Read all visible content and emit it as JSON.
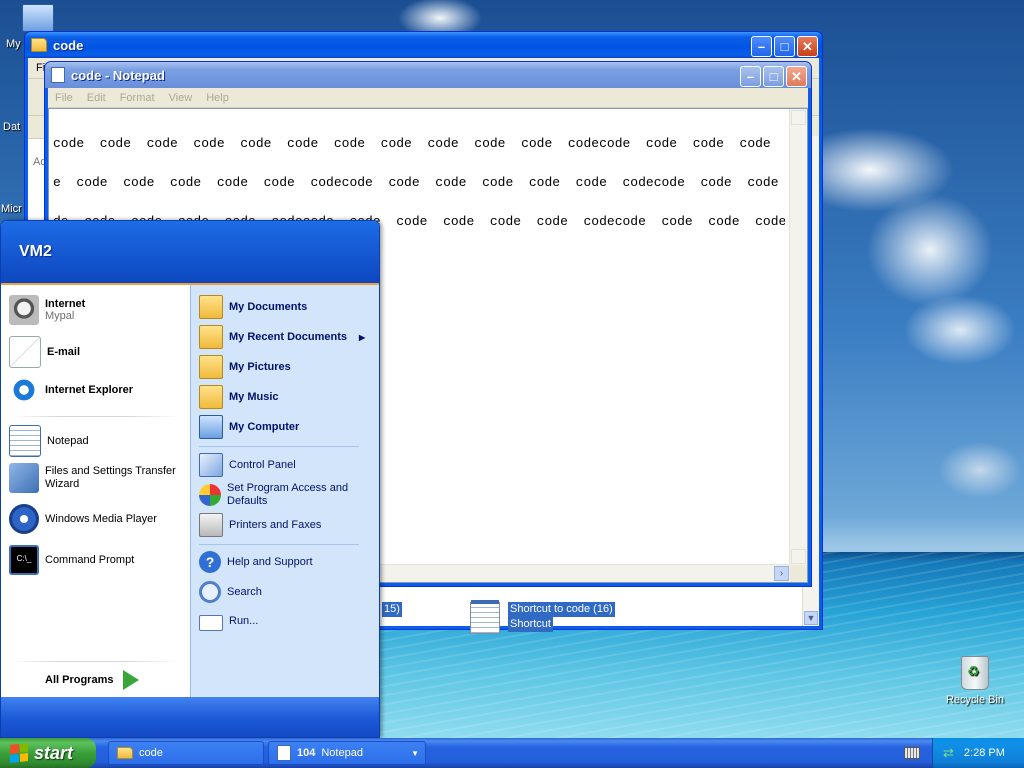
{
  "desktop": {
    "icons_left": [
      "My",
      "Dat",
      "Micr"
    ],
    "recycle_bin": "Recycle Bin"
  },
  "explorer": {
    "title": "code",
    "menu_first": "Fi",
    "toolbar_fragment": "Ad",
    "items": [
      {
        "label": "15)"
      },
      {
        "label": "Shortcut to code (16)",
        "sub": "Shortcut"
      }
    ]
  },
  "notepad": {
    "title": "code - Notepad",
    "menu": [
      "File",
      "Edit",
      "Format",
      "View",
      "Help"
    ],
    "lines": [
      "code  code  code  code  code  code  code  code  code  code  code  codecode  code  code  code  cod",
      "e  code  code  code  code  code  codecode  code  code  code  code  code  codecode  code  code  code  co",
      "de  code  code  code  code  codecode  code  code  code  code  code  codecode  code  code  code  code  c"
    ]
  },
  "startmenu": {
    "user": "VM2",
    "pinned": [
      {
        "label": "Internet",
        "sub": "Mypal",
        "icon": "raccoon-icon"
      },
      {
        "label": "E-mail",
        "icon": "email-icon"
      },
      {
        "label": "Internet Explorer",
        "icon": "ie-icon"
      }
    ],
    "recent": [
      {
        "label": "Notepad",
        "icon": "notepad-icon"
      },
      {
        "label": "Files and Settings Transfer Wizard",
        "icon": "transfer-wizard-icon"
      },
      {
        "label": "Windows Media Player",
        "icon": "media-player-icon"
      },
      {
        "label": "Command Prompt",
        "icon": "command-prompt-icon"
      }
    ],
    "all_programs": "All Programs",
    "places": [
      {
        "label": "My Documents"
      },
      {
        "label": "My Recent Documents"
      },
      {
        "label": "My Pictures"
      },
      {
        "label": "My Music"
      },
      {
        "label": "My Computer"
      }
    ],
    "settings": [
      {
        "label": "Control Panel"
      },
      {
        "label": "Set Program Access and Defaults"
      },
      {
        "label": "Printers and Faxes"
      }
    ],
    "help": [
      {
        "label": "Help and Support"
      },
      {
        "label": "Search"
      },
      {
        "label": "Run..."
      }
    ]
  },
  "taskbar": {
    "start": "start",
    "tasks": [
      {
        "label": "code"
      },
      {
        "badge": "104",
        "label": "Notepad"
      }
    ],
    "clock": "2:28 PM"
  }
}
